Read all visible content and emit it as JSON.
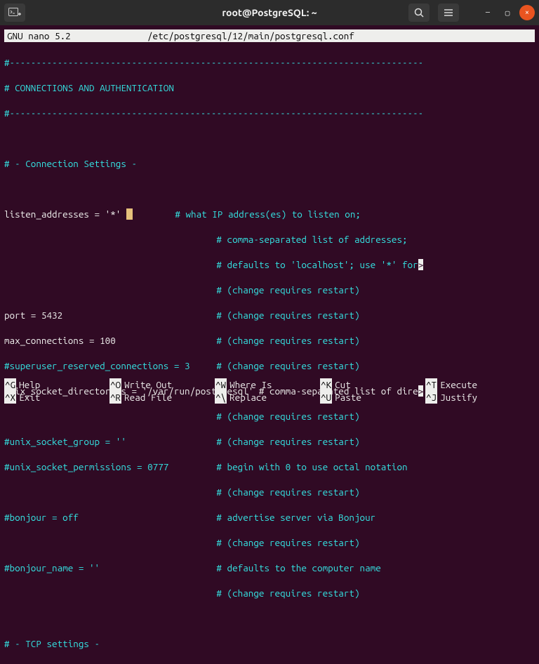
{
  "titlebar": {
    "title": "root@PostgreSQL: ~",
    "terminal_icon": "⌷",
    "search_icon": "search",
    "menu_icon": "menu",
    "minimize": "—",
    "maximize": "▢",
    "close": "×"
  },
  "nano": {
    "app": "  GNU nano 5.2",
    "file": "/etc/postgresql/12/main/postgresql.conf"
  },
  "lines": {
    "l01": "#------------------------------------------------------------------------------",
    "l02": "# CONNECTIONS AND AUTHENTICATION",
    "l03": "#------------------------------------------------------------------------------",
    "l05": "# - Connection Settings -",
    "l07a": "listen_addresses = '*' ",
    "l07b": "        # what IP address(es) to listen on;",
    "l08": "                                        # comma-separated list of addresses;",
    "l09a": "                                        # defaults to 'localhost'; use '*' for",
    "l09b": ">",
    "l10": "                                        # (change requires restart)",
    "l11a": "port = 5432",
    "l11b": "                             # (change requires restart)",
    "l12a": "max_connections = 100",
    "l12b": "                   # (change requires restart)",
    "l13": "#superuser_reserved_connections = 3     # (change requires restart)",
    "l14a": "unix_socket_directories = '/var/run/postgresql' # comma-separated list of dire",
    "l14b": ">",
    "l15": "                                        # (change requires restart)",
    "l16": "#unix_socket_group = ''                 # (change requires restart)",
    "l17": "#unix_socket_permissions = 0777         # begin with 0 to use octal notation",
    "l18": "                                        # (change requires restart)",
    "l19": "#bonjour = off                          # advertise server via Bonjour",
    "l20": "                                        # (change requires restart)",
    "l21": "#bonjour_name = ''                      # defaults to the computer name",
    "l22": "                                        # (change requires restart)",
    "l24": "# - TCP settings -"
  },
  "shortcuts": {
    "r1": [
      {
        "key": "^G",
        "label": "Help"
      },
      {
        "key": "^O",
        "label": "Write Out"
      },
      {
        "key": "^W",
        "label": "Where Is"
      },
      {
        "key": "^K",
        "label": "Cut"
      },
      {
        "key": "^T",
        "label": "Execute"
      }
    ],
    "r2": [
      {
        "key": "^X",
        "label": "Exit"
      },
      {
        "key": "^R",
        "label": "Read File"
      },
      {
        "key": "^\\",
        "label": "Replace"
      },
      {
        "key": "^U",
        "label": "Paste"
      },
      {
        "key": "^J",
        "label": "Justify"
      }
    ]
  }
}
